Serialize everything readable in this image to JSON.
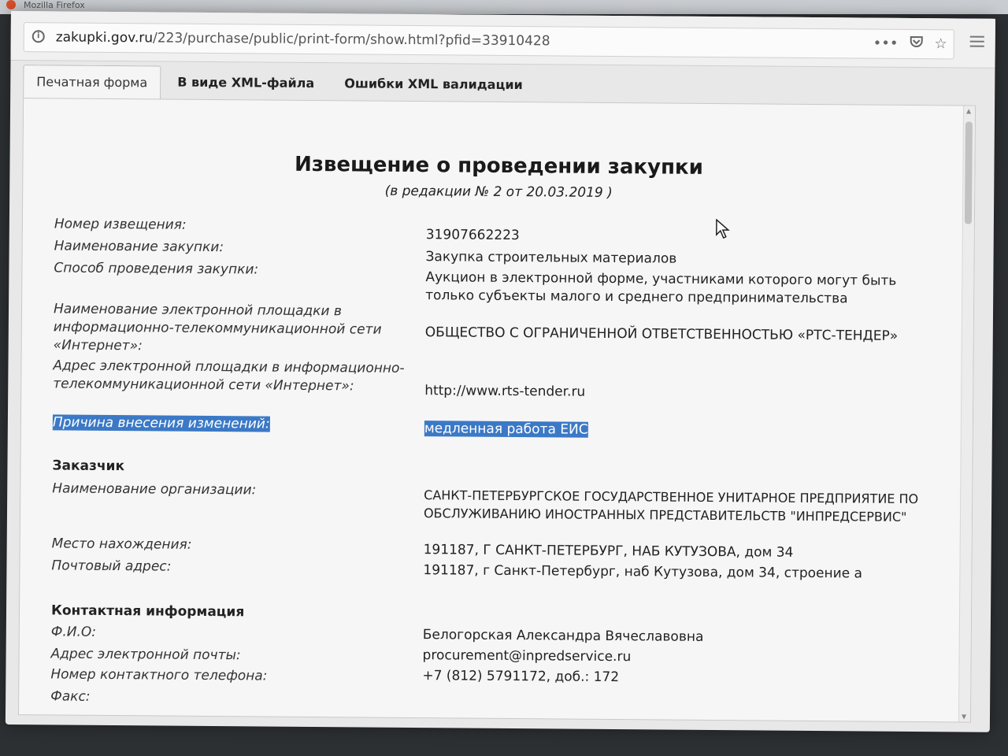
{
  "window": {
    "title": "Mozilla Firefox"
  },
  "urlbar": {
    "host": "zakupki.gov.ru",
    "path": "/223/purchase/public/print-form/show.html?pfid=33910428",
    "page_actions_icon": "ellipsis-icon",
    "pocket_icon": "pocket-icon",
    "bookmark_icon": "star-icon",
    "menu_icon": "hamburger-menu-icon"
  },
  "tabs": [
    {
      "label": "Печатная форма",
      "active": true
    },
    {
      "label": "В виде XML-файла",
      "active": false
    },
    {
      "label": "Ошибки XML валидации",
      "active": false
    }
  ],
  "document": {
    "title": "Извещение о проведении закупки",
    "subtitle": "(в редакции № 2 от 20.03.2019 )",
    "fields": [
      {
        "label": "Номер извещения:",
        "value": "31907662223"
      },
      {
        "label": "Наименование закупки:",
        "value": "Закупка строительных материалов"
      },
      {
        "label": "Способ проведения закупки:",
        "value": "Аукцион в электронной форме, участниками которого могут быть только субъекты малого и среднего предпринимательства"
      },
      {
        "label": "Наименование электронной площадки в информационно-телекоммуникационной сети «Интернет»:",
        "value": "ОБЩЕСТВО С ОГРАНИЧЕННОЙ ОТВЕТСТВЕННОСТЬЮ «РТС-ТЕНДЕР»"
      },
      {
        "label": "Адрес электронной площадки в информационно-телекоммуникационной сети «Интернет»:",
        "value": "http://www.rts-tender.ru"
      },
      {
        "label": "Причина внесения изменений:",
        "value": "медленная работа ЕИС"
      }
    ],
    "customer": {
      "heading": "Заказчик",
      "fields": [
        {
          "label": "Наименование организации:",
          "value": "САНКТ-ПЕТЕРБУРГСКОЕ ГОСУДАРСТВЕННОЕ УНИТАРНОЕ ПРЕДПРИЯТИЕ ПО ОБСЛУЖИВАНИЮ ИНОСТРАННЫХ ПРЕДСТАВИТЕЛЬСТВ \"ИНПРЕДСЕРВИС\""
        },
        {
          "label": "Место нахождения:",
          "value": "191187, Г САНКТ-ПЕТЕРБУРГ, НАБ КУТУЗОВА, дом 34"
        },
        {
          "label": "Почтовый адрес:",
          "value": "191187, г Санкт-Петербург, наб Кутузова, дом 34, строение а"
        }
      ]
    },
    "contact": {
      "heading": "Контактная информация",
      "fields": [
        {
          "label": "Ф.И.О:",
          "value": "Белогорская Александра Вячеславовна"
        },
        {
          "label": "Адрес электронной почты:",
          "value": "procurement@inpredservice.ru"
        },
        {
          "label": "Номер контактного телефона:",
          "value": "+7 (812) 5791172, доб.: 172"
        },
        {
          "label": "Факс:",
          "value": ""
        }
      ]
    }
  },
  "colors": {
    "selection": "#3b79c6"
  }
}
